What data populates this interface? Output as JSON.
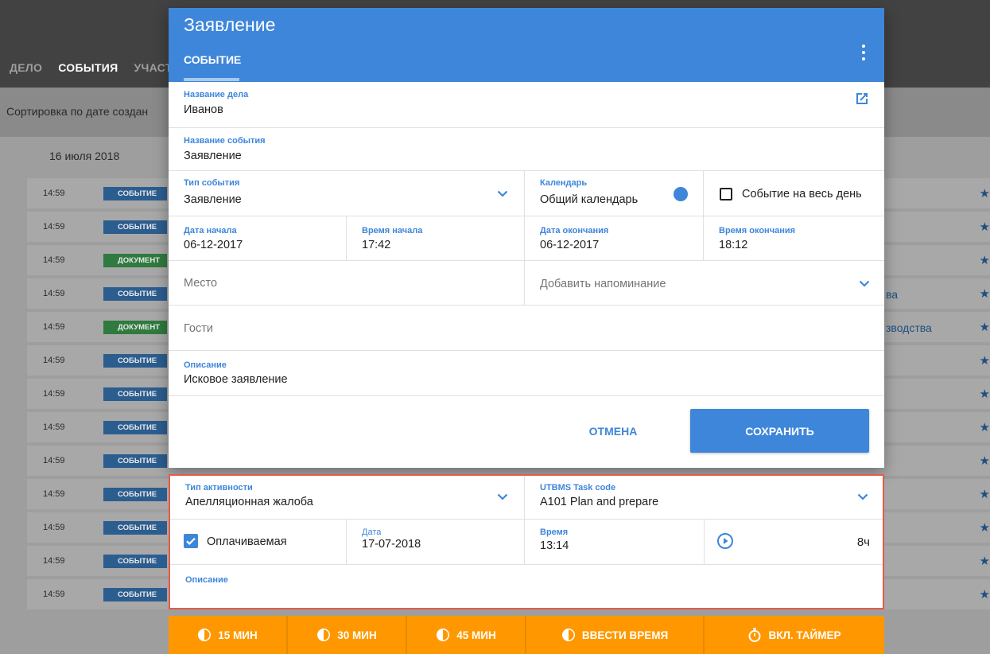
{
  "background": {
    "tabs": [
      "ДЕЛО",
      "СОБЫТИЯ",
      "УЧАСТ"
    ],
    "active_tab": "СОБЫТИЯ",
    "sort_text": "Сортировка по дате создан",
    "date_header": "16 июля 2018",
    "rows": [
      {
        "time": "14:59",
        "badge": "СОБЫТИЕ",
        "kind": "ev",
        "right": ""
      },
      {
        "time": "14:59",
        "badge": "СОБЫТИЕ",
        "kind": "ev",
        "right": ""
      },
      {
        "time": "14:59",
        "badge": "ДОКУМЕНТ",
        "kind": "doc",
        "right": ""
      },
      {
        "time": "14:59",
        "badge": "СОБЫТИЕ",
        "kind": "ev",
        "right": "ва"
      },
      {
        "time": "14:59",
        "badge": "ДОКУМЕНТ",
        "kind": "doc",
        "right": "зводства"
      },
      {
        "time": "14:59",
        "badge": "СОБЫТИЕ",
        "kind": "ev",
        "right": ""
      },
      {
        "time": "14:59",
        "badge": "СОБЫТИЕ",
        "kind": "ev",
        "right": ""
      },
      {
        "time": "14:59",
        "badge": "СОБЫТИЕ",
        "kind": "ev",
        "right": ""
      },
      {
        "time": "14:59",
        "badge": "СОБЫТИЕ",
        "kind": "ev",
        "right": ""
      },
      {
        "time": "14:59",
        "badge": "СОБЫТИЕ",
        "kind": "ev",
        "right": ""
      },
      {
        "time": "14:59",
        "badge": "СОБЫТИЕ",
        "kind": "ev",
        "right": ""
      },
      {
        "time": "14:59",
        "badge": "СОБЫТИЕ",
        "kind": "ev",
        "right": ""
      },
      {
        "time": "14:59",
        "badge": "СОБЫТИЕ",
        "kind": "ev",
        "right": ""
      }
    ]
  },
  "dialog": {
    "title": "Заявление",
    "tab": "СОБЫТИЕ",
    "case_name_label": "Название дела",
    "case_name_value": "Иванов",
    "event_name_label": "Название события",
    "event_name_value": "Заявление",
    "event_type_label": "Тип события",
    "event_type_value": "Заявление",
    "calendar_label": "Календарь",
    "calendar_value": "Общий календарь",
    "calendar_color": "#3e86da",
    "all_day_label": "Событие на весь день",
    "all_day_checked": false,
    "start_date_label": "Дата начала",
    "start_date_value": "06-12-2017",
    "start_time_label": "Время начала",
    "start_time_value": "17:42",
    "end_date_label": "Дата окончания",
    "end_date_value": "06-12-2017",
    "end_time_label": "Время окончания",
    "end_time_value": "18:12",
    "place_placeholder": "Место",
    "reminder_placeholder": "Добавить напоминание",
    "guests_placeholder": "Гости",
    "description_label": "Описание",
    "description_value": "Исковое заявление",
    "cancel_label": "ОТМЕНА",
    "save_label": "СОХРАНИТЬ"
  },
  "time_entry": {
    "activity_type_label": "Тип активности",
    "activity_type_value": "Апелляционная жалоба",
    "task_code_label": "UTBMS Task code",
    "task_code_value": "A101 Plan and prepare",
    "billable_label": "Оплачиваемая",
    "billable_checked": true,
    "date_label": "Дата",
    "date_value": "17-07-2018",
    "time_label": "Время",
    "time_value": "13:14",
    "hours_value": "8ч",
    "description_label": "Описание"
  },
  "action_bar": {
    "btn_15": "15 МИН",
    "btn_30": "30 МИН",
    "btn_45": "45 МИН",
    "btn_enter": "ВВЕСТИ ВРЕМЯ",
    "btn_timer": "ВКЛ. ТАЙМЕР"
  },
  "colors": {
    "primary": "#3e86da",
    "accent_orange": "#ff9800",
    "highlight_border": "#e55b4b"
  }
}
